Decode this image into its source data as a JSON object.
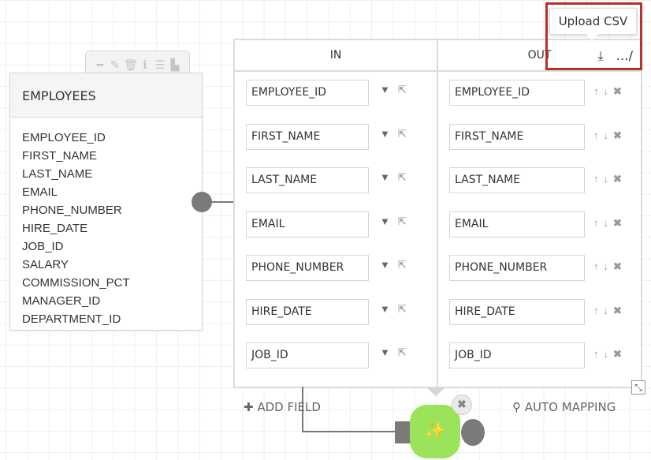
{
  "entity": {
    "title": "EMPLOYEES",
    "toolbar_icons": [
      {
        "name": "minus-icon",
        "glyph": "━"
      },
      {
        "name": "pencil-icon",
        "glyph": "✎"
      },
      {
        "name": "trash-icon",
        "glyph": "🗑"
      },
      {
        "name": "info-icon",
        "glyph": "ℹ"
      },
      {
        "name": "database-icon",
        "glyph": "☰"
      },
      {
        "name": "document-icon",
        "glyph": "▙"
      }
    ],
    "fields": [
      "EMPLOYEE_ID",
      "FIRST_NAME",
      "LAST_NAME",
      "EMAIL",
      "PHONE_NUMBER",
      "HIRE_DATE",
      "JOB_ID",
      "SALARY",
      "COMMISSION_PCT",
      "MANAGER_ID",
      "DEPARTMENT_ID"
    ]
  },
  "mapping": {
    "in_header": "IN",
    "out_header": "OUT",
    "in_fields": [
      "EMPLOYEE_ID",
      "FIRST_NAME",
      "LAST_NAME",
      "EMAIL",
      "PHONE_NUMBER",
      "HIRE_DATE",
      "JOB_ID",
      ""
    ],
    "out_fields": [
      "EMPLOYEE_ID",
      "FIRST_NAME",
      "LAST_NAME",
      "EMAIL",
      "PHONE_NUMBER",
      "HIRE_DATE",
      "JOB_ID",
      ""
    ],
    "icons": {
      "dropdown": "▼",
      "external_link": "⇱",
      "move_up": "↑",
      "move_down": "↓",
      "remove": "✖",
      "upload": "⤓",
      "edit": "…∕",
      "resize": "⤡"
    }
  },
  "tooltip": {
    "text": "Upload CSV"
  },
  "footer": {
    "add_field_icon": "✚",
    "add_field_label": "ADD FIELD",
    "auto_mapping_icon": "⚲",
    "auto_mapping_label": "AUTO MAPPING"
  },
  "node": {
    "icon": "✨",
    "close_icon": "✖",
    "color": "#9be35a"
  },
  "colors": {
    "highlight": "#b5312b"
  }
}
